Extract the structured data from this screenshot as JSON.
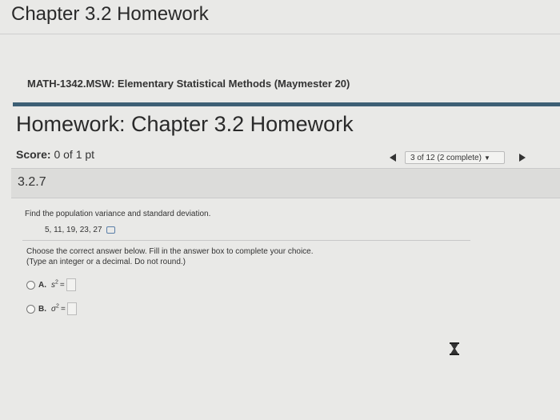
{
  "page": {
    "title": "Chapter 3.2 Homework"
  },
  "course": {
    "name": "MATH-1342.MSW: Elementary Statistical Methods (Maymester 20)"
  },
  "homework": {
    "heading": "Homework: Chapter 3.2 Homework",
    "score_label": "Score:",
    "score_value": "0 of 1 pt"
  },
  "nav": {
    "position_text": "3 of 12 (2 complete)",
    "prev_icon": "triangle-left-icon",
    "next_icon": "triangle-right-icon"
  },
  "question": {
    "number": "3.2.7",
    "prompt": "Find the population variance and standard deviation.",
    "data_values": "5, 11, 19, 23, 27",
    "instruction": "Choose the correct answer below. Fill in the answer box to complete your choice.",
    "hint": "(Type an integer or a decimal. Do not round.)",
    "options": [
      {
        "letter": "A.",
        "symbol": "s",
        "power": "2",
        "equals": "="
      },
      {
        "letter": "B.",
        "symbol": "σ",
        "power": "2",
        "equals": "="
      }
    ]
  }
}
